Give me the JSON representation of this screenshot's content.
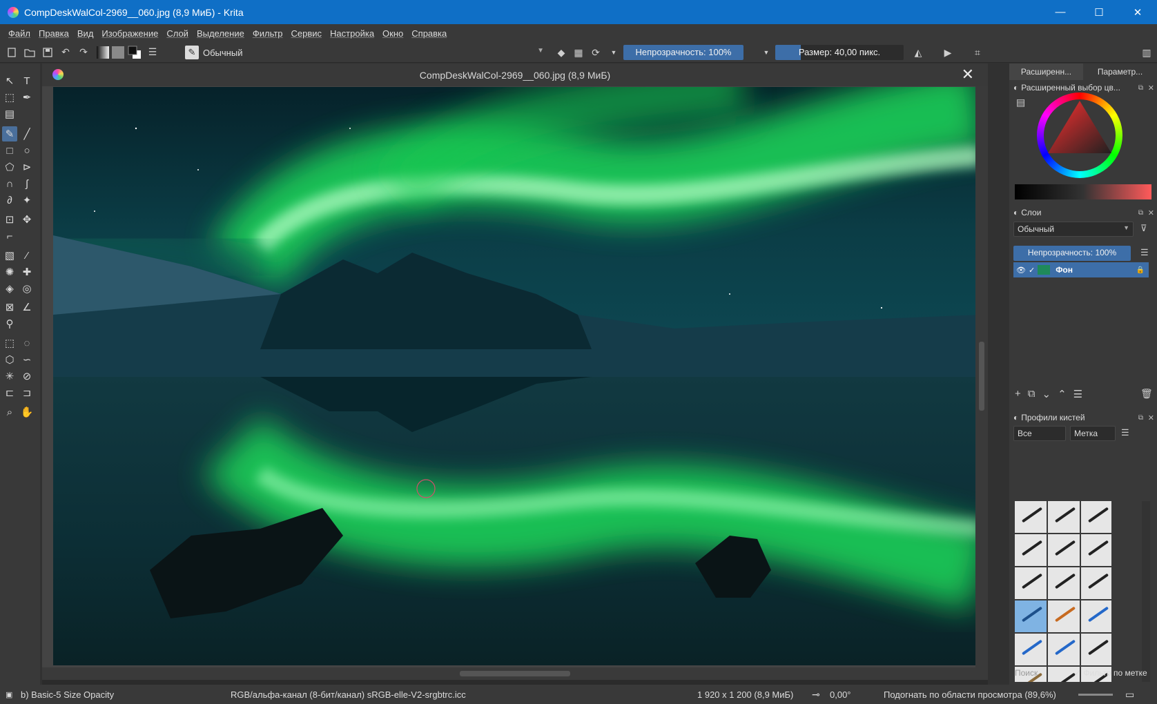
{
  "window": {
    "title": "CompDeskWalCol-2969__060.jpg (8,9 МиБ)  - Krita",
    "minimize": "—",
    "maximize": "☐",
    "close": "✕"
  },
  "menu": [
    "Файл",
    "Правка",
    "Вид",
    "Изображение",
    "Слой",
    "Выделение",
    "Фильтр",
    "Сервис",
    "Настройка",
    "Окно",
    "Справка"
  ],
  "toolbar": {
    "blend_mode": "Обычный",
    "opacity": "Непрозрачность: 100%",
    "opacity_fraction": 1.0,
    "size": "Размер: 40,00 пикс.",
    "size_fraction": 0.2
  },
  "document": {
    "tab_title": "CompDeskWalCol-2969__060.jpg (8,9 МиБ)",
    "close": "✕"
  },
  "dock": {
    "tab_advanced": "Расширенн...",
    "tab_params": "Параметр...",
    "color_selector_title": "Расширенный выбор цв...",
    "layers_title": "Слои",
    "layers_blend": "Обычный",
    "layers_opacity": "Непрозрачность: 100%",
    "layer_name": "Фон",
    "brushes_title": "Профили кистей",
    "brushes_filter": "Все",
    "brushes_tag": "Метка",
    "search_placeholder": "Поиск",
    "tag_filter": "Фильтр по метке"
  },
  "status": {
    "brush": "b) Basic-5 Size Opacity",
    "colorspace": "RGB/альфа-канал (8-бит/канал)  sRGB-elle-V2-srgbtrc.icc",
    "dimensions": "1 920 x 1 200 (8,9 МиБ)",
    "rotation": "0,00°",
    "zoom": "Подогнать по области просмотра (89,6%)"
  },
  "colors": {
    "accent": "#3d6ea8",
    "titlebar": "#0f6fc6",
    "aurora": "#2dff6a"
  }
}
